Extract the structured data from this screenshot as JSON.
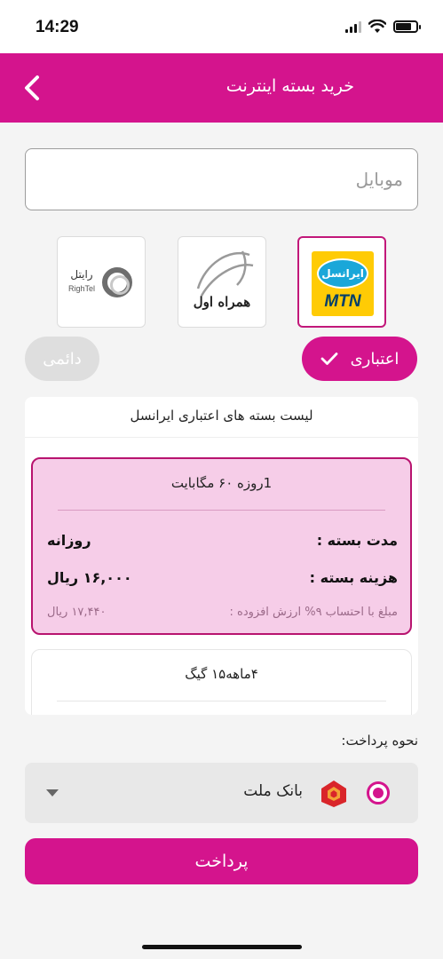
{
  "status": {
    "time": "14:29",
    "battery_level": 0.75
  },
  "header": {
    "title": "خرید بسته اینترنت",
    "back_icon": "chevron-left-icon"
  },
  "mobile_input": {
    "placeholder": "موبایل",
    "value": ""
  },
  "operators": [
    {
      "id": "irancell",
      "logo_fa": "ایرانسل",
      "logo_en": "MTN",
      "selected": true
    },
    {
      "id": "hamrah-aval",
      "logo_fa": "همراه اول",
      "selected": false
    },
    {
      "id": "rightel",
      "logo_fa": "رایتل",
      "logo_en": "RighTel",
      "selected": false
    }
  ],
  "sim_types": {
    "active": "اعتباری",
    "inactive": "دائمی"
  },
  "package_list": {
    "title": "لیست بسته های اعتباری ایرانسل",
    "selected": {
      "name": "1روزه ۶۰ مگابایت",
      "duration_label": "مدت بسته :",
      "duration_value": "روزانه",
      "cost_label": "هزینه بسته :",
      "cost_value": "۱۶,۰۰۰ ریال",
      "vat_label": "مبلغ با احتساب ۹% ارزش افزوده :",
      "vat_value": "۱۷,۴۴۰ ریال"
    },
    "next": {
      "name": "۴ماهه۱۵ گیگ"
    }
  },
  "payment": {
    "label": "نحوه پرداخت:",
    "bank": "بانک ملت",
    "selected": true
  },
  "pay_button": {
    "label": "پرداخت"
  },
  "colors": {
    "accent": "#d4148d",
    "selected_card_bg": "#f6cde8",
    "irancell_yellow": "#ffcb05",
    "irancell_blue": "#1aa7d9"
  }
}
